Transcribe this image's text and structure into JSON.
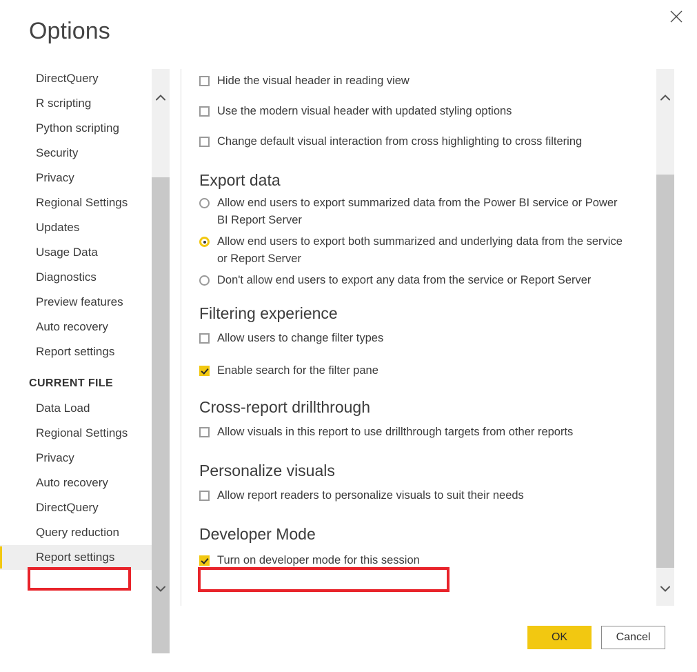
{
  "dialog": {
    "title": "Options",
    "close_icon": "close-icon"
  },
  "sidebar": {
    "global_items": [
      {
        "label": "DirectQuery"
      },
      {
        "label": "R scripting"
      },
      {
        "label": "Python scripting"
      },
      {
        "label": "Security"
      },
      {
        "label": "Privacy"
      },
      {
        "label": "Regional Settings"
      },
      {
        "label": "Updates"
      },
      {
        "label": "Usage Data"
      },
      {
        "label": "Diagnostics"
      },
      {
        "label": "Preview features"
      },
      {
        "label": "Auto recovery"
      },
      {
        "label": "Report settings"
      }
    ],
    "group_header": "CURRENT FILE",
    "current_file_items": [
      {
        "label": "Data Load",
        "selected": false
      },
      {
        "label": "Regional Settings",
        "selected": false
      },
      {
        "label": "Privacy",
        "selected": false
      },
      {
        "label": "Auto recovery",
        "selected": false
      },
      {
        "label": "DirectQuery",
        "selected": false
      },
      {
        "label": "Query reduction",
        "selected": false
      },
      {
        "label": "Report settings",
        "selected": true
      }
    ],
    "scroll_up_icon": "chevron-up-icon",
    "scroll_down_icon": "chevron-down-icon"
  },
  "content": {
    "top_checkboxes": [
      {
        "label": "Hide the visual header in reading view",
        "checked": false
      },
      {
        "label": "Use the modern visual header with updated styling options",
        "checked": false
      },
      {
        "label": "Change default visual interaction from cross highlighting to cross filtering",
        "checked": false
      }
    ],
    "export_data": {
      "heading": "Export data",
      "options": [
        {
          "label": "Allow end users to export summarized data from the Power BI service or Power BI Report Server",
          "checked": false
        },
        {
          "label": "Allow end users to export both summarized and underlying data from the service or Report Server",
          "checked": true
        },
        {
          "label": "Don't allow end users to export any data from the service or Report Server",
          "checked": false
        }
      ]
    },
    "filtering_experience": {
      "heading": "Filtering experience",
      "options": [
        {
          "label": "Allow users to change filter types",
          "checked": false
        },
        {
          "label": "Enable search for the filter pane",
          "checked": true
        }
      ]
    },
    "cross_report_drillthrough": {
      "heading": "Cross-report drillthrough",
      "options": [
        {
          "label": "Allow visuals in this report to use drillthrough targets from other reports",
          "checked": false
        }
      ]
    },
    "personalize_visuals": {
      "heading": "Personalize visuals",
      "options": [
        {
          "label": "Allow report readers to personalize visuals to suit their needs",
          "checked": false
        }
      ]
    },
    "developer_mode": {
      "heading": "Developer Mode",
      "options": [
        {
          "label": "Turn on developer mode for this session",
          "checked": true
        }
      ]
    },
    "scroll_up_icon": "chevron-up-icon",
    "scroll_down_icon": "chevron-down-icon"
  },
  "footer": {
    "ok_label": "OK",
    "cancel_label": "Cancel"
  },
  "colors": {
    "accent": "#f2c811",
    "annotation": "#e8232a",
    "text": "#3b3b3b",
    "scrollbar_thumb": "#c8c8c8"
  }
}
